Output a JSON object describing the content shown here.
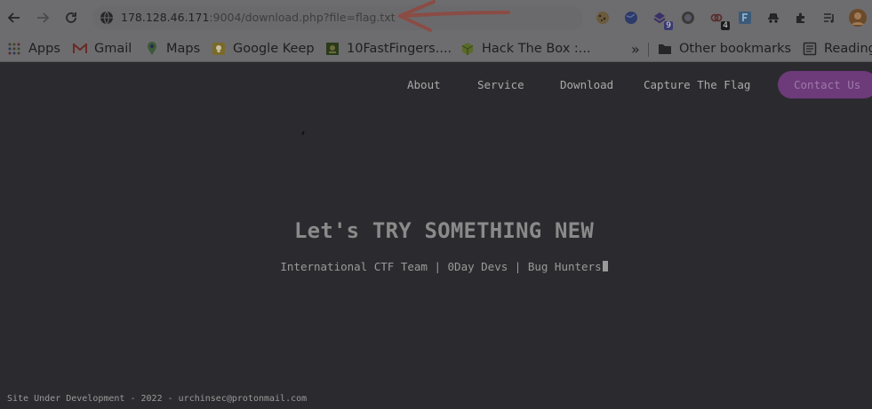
{
  "browser": {
    "url_host": "178.128.46.171",
    "url_rest": ":9004/download.php?file=flag.txt",
    "extension_badges": [
      "9",
      "4"
    ]
  },
  "bookmarks": {
    "items": [
      {
        "label": "Apps",
        "icon": "apps-grid-icon"
      },
      {
        "label": "Gmail",
        "icon": "gmail-icon"
      },
      {
        "label": "Maps",
        "icon": "maps-pin-icon"
      },
      {
        "label": "Google Keep",
        "icon": "keep-bulb-icon"
      },
      {
        "label": "10FastFingers....",
        "icon": "fastfingers-icon"
      },
      {
        "label": "Hack The Box :...",
        "icon": "htb-cube-icon"
      }
    ],
    "overflow": "»",
    "other": "Other bookmarks",
    "reading": "Reading"
  },
  "site": {
    "nav": [
      "About",
      "Service",
      "Download",
      "Capture The Flag"
    ],
    "contact": "Contact Us",
    "hero_title": "Let's TRY SOMETHING NEW",
    "hero_sub": "International CTF Team | 0Day Devs | Bug Hunters",
    "footer": "Site Under Development - 2022 - urchinsec@protonmail.com"
  },
  "colors": {
    "page_bg": "#2b2b2f",
    "chrome_bg": "#6d6d6f",
    "contact_bg": "#6d3a7a",
    "annotation_arrow": "#8a4c44"
  }
}
